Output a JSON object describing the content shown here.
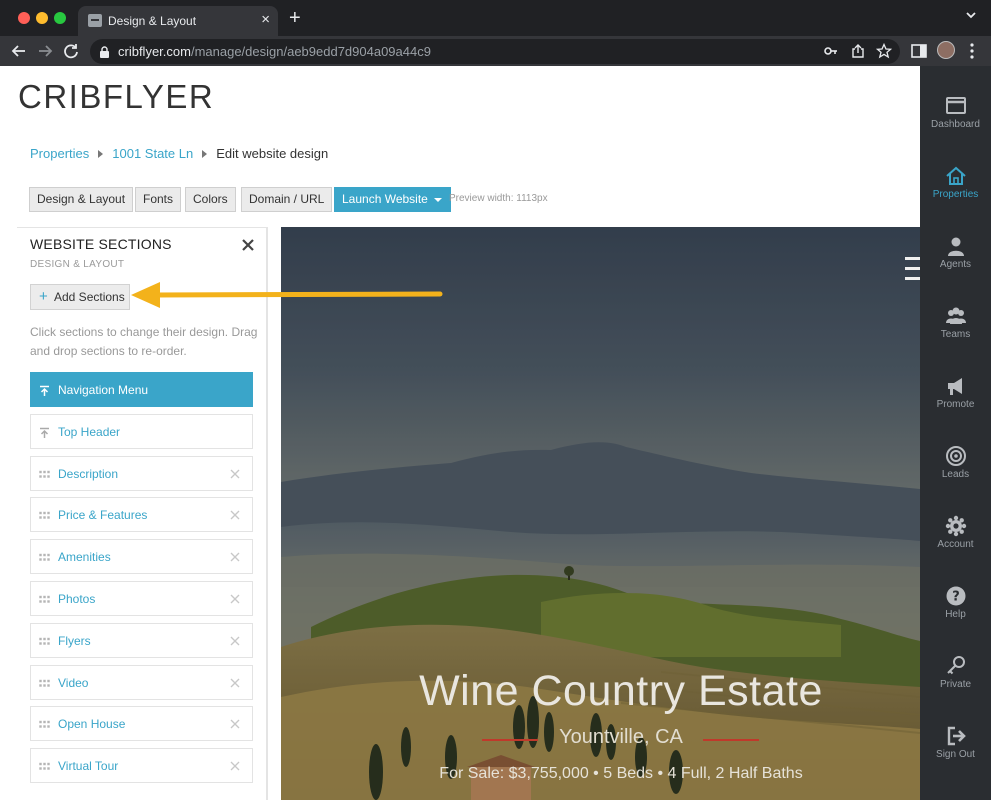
{
  "browser": {
    "tab_title": "Design & Layout",
    "tab_close": "×",
    "new_tab": "+",
    "url_host": "cribflyer.com",
    "url_path": "/manage/design/aeb9edd7d904a09a44c9"
  },
  "app": {
    "logo": "CRIBFLYER"
  },
  "breadcrumb": {
    "items": [
      "Properties",
      "1001 State Ln"
    ],
    "current": "Edit website design"
  },
  "toolbar": {
    "buttons": [
      "Design & Layout",
      "Fonts",
      "Colors",
      "Domain / URL"
    ],
    "launch_label": "Launch Website",
    "preview_width": "Preview width: 1113px"
  },
  "panel": {
    "title": "WEBSITE SECTIONS",
    "subtitle": "DESIGN & LAYOUT",
    "add_sections_label": "Add Sections",
    "hint": "Click sections to change their design. Drag and drop sections to re-order.",
    "sections": [
      {
        "label": "Navigation Menu",
        "icon": "pin-top-icon",
        "active": true
      },
      {
        "label": "Top Header",
        "icon": "pin-top-icon",
        "active": false
      },
      {
        "label": "Description",
        "icon": "drag-handle-icon",
        "active": false
      },
      {
        "label": "Price & Features",
        "icon": "drag-handle-icon",
        "active": false
      },
      {
        "label": "Amenities",
        "icon": "drag-handle-icon",
        "active": false
      },
      {
        "label": "Photos",
        "icon": "drag-handle-icon",
        "active": false
      },
      {
        "label": "Flyers",
        "icon": "drag-handle-icon",
        "active": false
      },
      {
        "label": "Video",
        "icon": "drag-handle-icon",
        "active": false
      },
      {
        "label": "Open House",
        "icon": "drag-handle-icon",
        "active": false
      },
      {
        "label": "Virtual Tour",
        "icon": "drag-handle-icon",
        "active": false
      }
    ]
  },
  "preview": {
    "title": "Wine Country Estate",
    "location": "Yountville, CA",
    "details": "For Sale: $3,755,000 • 5 Beds • 4 Full, 2 Half Baths"
  },
  "sidebar": {
    "items": [
      {
        "label": "Dashboard",
        "icon": "dashboard-icon",
        "active": false
      },
      {
        "label": "Properties",
        "icon": "home-icon",
        "active": true
      },
      {
        "label": "Agents",
        "icon": "user-icon",
        "active": false
      },
      {
        "label": "Teams",
        "icon": "team-icon",
        "active": false
      },
      {
        "label": "Promote",
        "icon": "megaphone-icon",
        "active": false
      },
      {
        "label": "Leads",
        "icon": "target-icon",
        "active": false
      },
      {
        "label": "Account",
        "icon": "gear-icon",
        "active": false
      },
      {
        "label": "Help",
        "icon": "help-icon",
        "active": false
      },
      {
        "label": "Private",
        "icon": "key-icon",
        "active": false
      },
      {
        "label": "Sign Out",
        "icon": "sign-out-icon",
        "active": false
      }
    ]
  },
  "colors": {
    "accent": "#3aa5c9",
    "sidebar_bg": "#2a2d31",
    "arrow": "#f3b21b",
    "hero_underline": "#c0392b"
  }
}
